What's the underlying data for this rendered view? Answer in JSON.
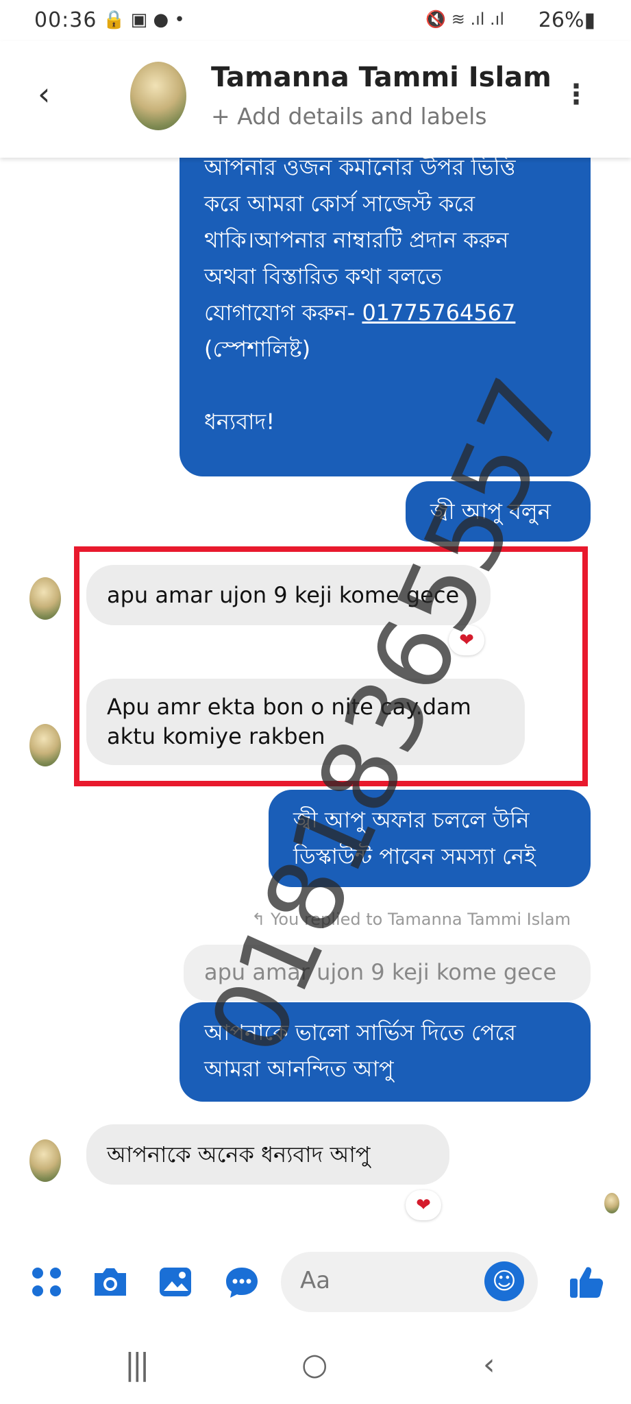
{
  "status_bar": {
    "time": "00:36",
    "left_icons": "🔒 ▣ ●  •",
    "right_icons": "🔇 ≋ .ıl .ıl",
    "battery": "26%▮"
  },
  "header": {
    "back_glyph": "‹",
    "contact_name": "Tamanna Tammi Islam",
    "contact_sub": "+ Add details and labels",
    "more_glyph": "⋮"
  },
  "messages": {
    "out1_lines": [
      "আপনার ওজন কমানোর উপর ভিত্তি",
      "করে আমরা কোর্স সাজেস্ট করে",
      "থাকি।আপনার নাম্বারটি প্রদান করুন",
      "অথবা  বিস্তারিত কথা বলতে",
      "যোগাযোগ করুন- "
    ],
    "out1_phone": "01775764567",
    "out1_specialist": "(স্পেশালিষ্ট)",
    "out1_thanks": "ধন্যবাদ!",
    "out2": "জ্বী আপু বলুন",
    "in1": "apu amar ujon 9 keji kome gece",
    "in1_reaction": "❤",
    "in2_line1": "Apu amr ekta bon o nite cay.dam",
    "in2_line2": "aktu komiye rakben",
    "out3_line1": "জ্বী আপু অফার চললে উনি",
    "out3_line2": "ডিস্কাউন্ট পাবেন সমস্যা নেই",
    "reply_note": "↰ You replied to Tamanna Tammi Islam",
    "quoted": "apu amar ujon 9 keji kome gece",
    "out4_line1": "আপনাকে ভালো সার্ভিস দিতে পেরে",
    "out4_line2": "আমরা আনন্দিত আপু",
    "in3": "আপনাকে অনেক ধন্যবাদ আপু",
    "in3_reaction": "❤"
  },
  "watermark": "01818365557",
  "composer": {
    "placeholder": "Aa",
    "menu_icon": "⁘",
    "camera_icon": "📷",
    "gallery_icon": "🖼",
    "mic_icon": "💬",
    "emoji_icon": "☺",
    "like_icon": "👍"
  },
  "navbar": {
    "recent": "|||",
    "home": "○",
    "back": "‹"
  }
}
